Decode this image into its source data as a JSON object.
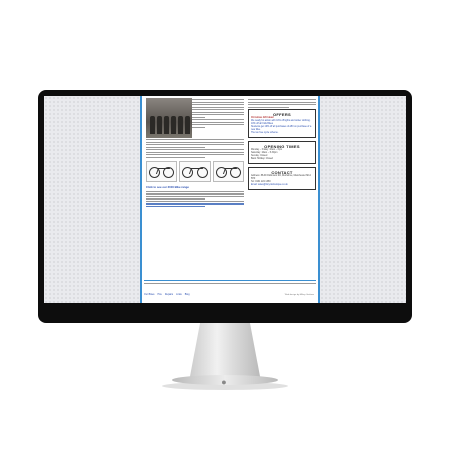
{
  "page": {
    "offers_title": "OFFERS",
    "offers_lines": [
      "Christmas Gift Ideas!",
      "We ready for action with 10% off lights and winter clothing.",
      "10% off all Kids Bikes",
      "Students get 10% off all purchases of £50 on purchase of a new bike.",
      "The tax free cycle scheme."
    ],
    "opening_title": "OPENING TIMES",
    "opening_lines": [
      "Monday – Friday: 10am – 6pm",
      "Saturday: 10am – 5.30pm",
      "Sunday: Closed",
      "Bank Holiday: Closed"
    ],
    "contact_title": "CONTACT",
    "contact_lines": [
      "Address: 88-90 Dickinson Rd, Rusholme, Manchester M14 5HF",
      "Tel: 0161 224 1383",
      "Email: sales@bicycleboutique.co.uk"
    ],
    "bike_link": "Click to see our 2016 Bike range",
    "nav_items": [
      "Our Bikes",
      "Hire",
      "Repairs",
      "Links",
      "Blog"
    ],
    "copyright": "Web design by Mikey Graham"
  },
  "colors": {
    "accent": "#3a8fd1",
    "link": "#2a4fb0"
  }
}
